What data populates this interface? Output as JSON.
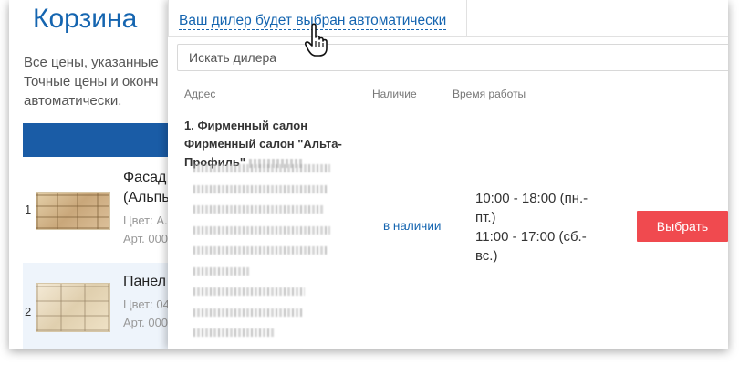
{
  "page": {
    "title": "Корзина",
    "notice_lines": [
      "Все цены, указанные",
      "Точные цены и оконч",
      "автоматически."
    ]
  },
  "cart": {
    "items": [
      {
        "number": "1",
        "name_lines": [
          "Фасад",
          "(Альпь"
        ],
        "color": "Цвет: А.",
        "article": "Арт. 000"
      },
      {
        "number": "2",
        "name_lines": [
          "Панел"
        ],
        "color": "Цвет: 04",
        "article": "Арт. 000"
      }
    ]
  },
  "dealer_popup": {
    "tab_link": "Ваш дилер будет выбран автоматически",
    "search": {
      "placeholder": "Искать дилера",
      "value": ""
    },
    "columns": {
      "address": "Адрес",
      "availability": "Наличие",
      "hours": "Время работы"
    },
    "dealers": [
      {
        "name_lines": [
          "1. Фирменный салон",
          "Фирменный салон \"Альта-",
          "Профиль\""
        ],
        "availability": "в наличии",
        "hours_lines": [
          "10:00 - 18:00 (пн.-",
          "пт.)",
          "11:00 - 17:00 (сб.-",
          "вс.)"
        ],
        "select_label": "Выбрать"
      }
    ]
  },
  "colors": {
    "accent": "#1565b0",
    "header_bar": "#1a5ca6",
    "select_button": "#f04a4f"
  },
  "icons": {
    "cursor": "hand-pointer-icon"
  }
}
